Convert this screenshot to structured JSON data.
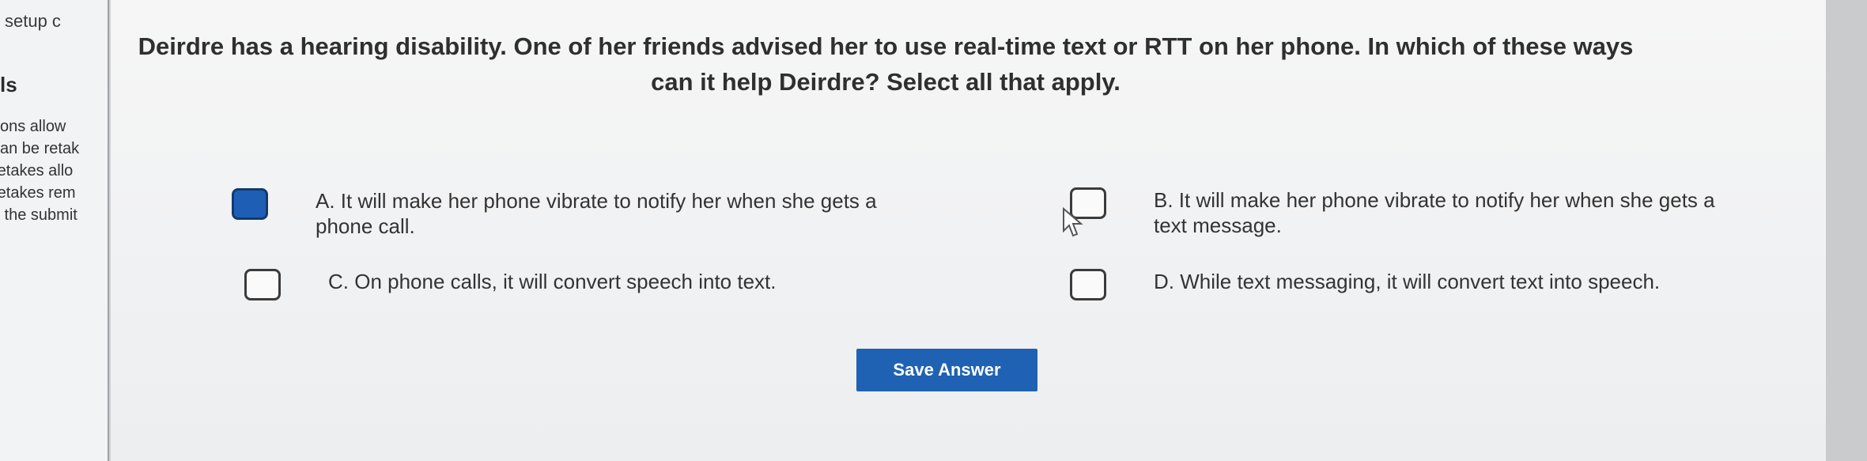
{
  "sidebar": {
    "setup_text": "setup c",
    "section_label": "ls",
    "notes": [
      "tions allow",
      "can be retak",
      "retakes allo",
      "retakes rem",
      "k the submit"
    ]
  },
  "question": {
    "text": "Deirdre has a hearing disability. One of her friends advised her to use real-time text or RTT on her phone. In which of these ways can it help Deirdre? Select all that apply."
  },
  "options": [
    {
      "id": "A",
      "text": "A. It will make her phone vibrate to notify her when she gets a phone call.",
      "checked": true
    },
    {
      "id": "B",
      "text": "B. It will make her phone vibrate to notify her when she gets a text message.",
      "checked": false
    },
    {
      "id": "C",
      "text": "C. On phone calls, it will convert speech into text.",
      "checked": false
    },
    {
      "id": "D",
      "text": "D. While text messaging, it will convert text into speech.",
      "checked": false
    }
  ],
  "save_button": {
    "label": "Save Answer"
  },
  "colors": {
    "accent": "#1f62b3",
    "checked": "#1e5fb5"
  },
  "icons": {
    "cursor": "pointer-arrow-icon"
  }
}
